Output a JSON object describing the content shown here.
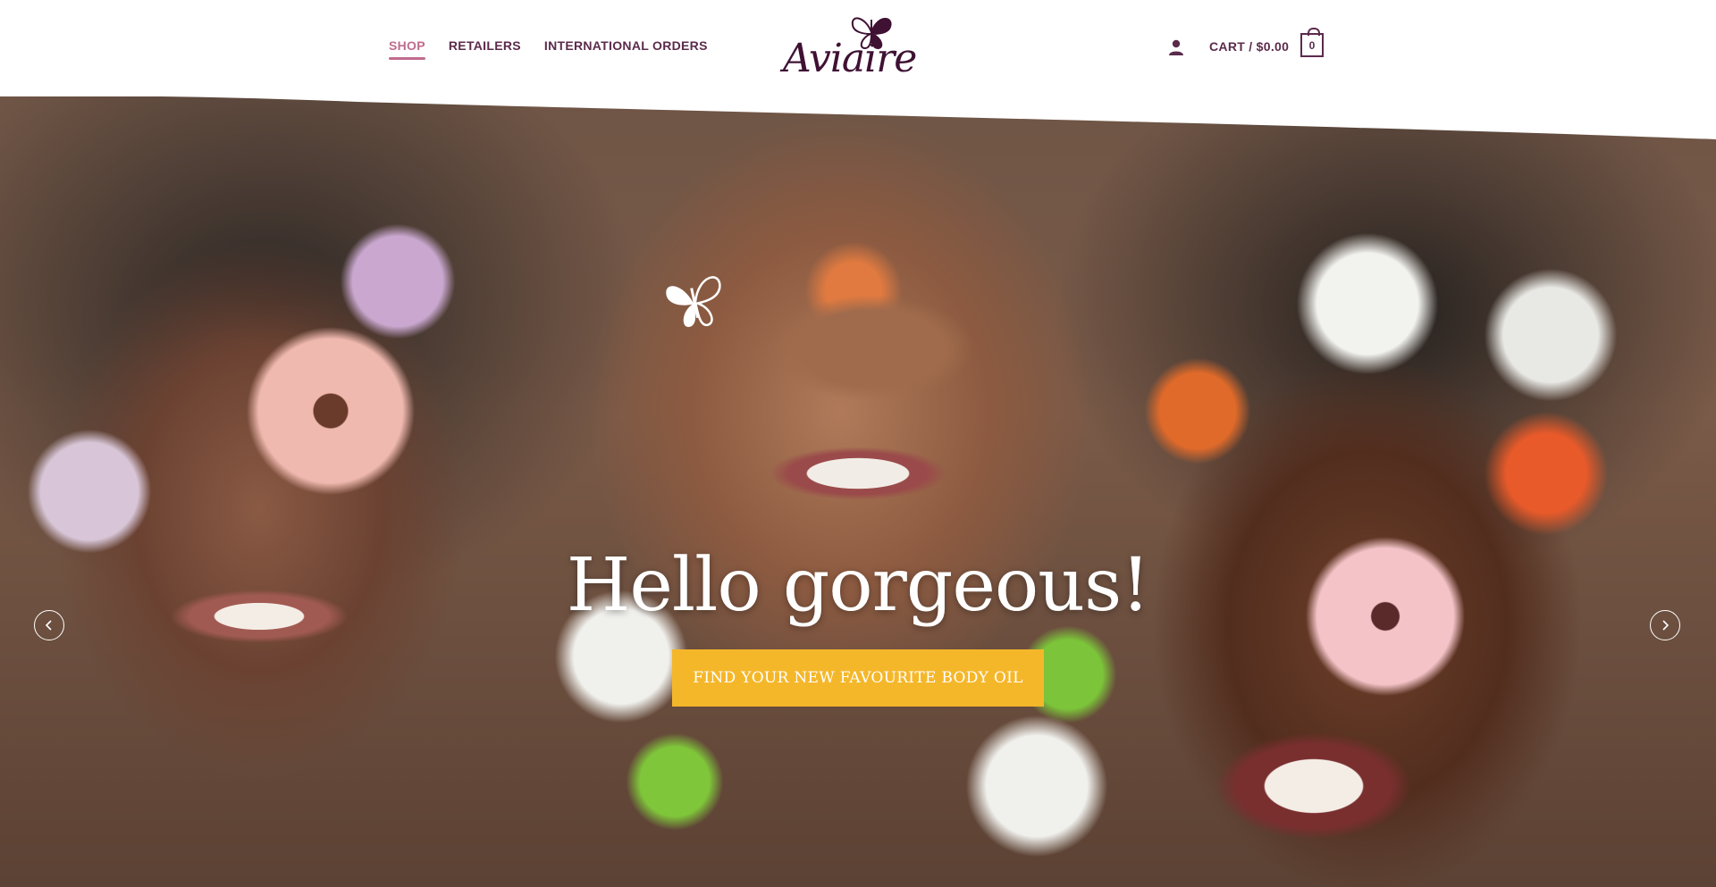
{
  "nav": {
    "items": [
      {
        "label": "SHOP",
        "active": true
      },
      {
        "label": "RETAILERS",
        "active": false
      },
      {
        "label": "INTERNATIONAL ORDERS",
        "active": false
      }
    ]
  },
  "logo": {
    "text": "Aviaire",
    "icon": "butterfly-icon"
  },
  "account": {
    "icon": "user-icon"
  },
  "cart": {
    "label": "CART / $0.00",
    "count": "0",
    "icon": "cart-bag-icon"
  },
  "hero": {
    "headline": "Hello gorgeous!",
    "cta_label": "FIND YOUR NEW FAVOURITE BODY OIL",
    "prev_icon": "chevron-left-icon",
    "next_icon": "chevron-right-icon",
    "decor_icon": "butterfly-icon"
  },
  "colors": {
    "brand": "#3f1133",
    "nav_text": "#5b2b4b",
    "nav_active": "#c06b8e",
    "cta_bg": "#f5b72a",
    "cta_text": "#ffffff"
  }
}
